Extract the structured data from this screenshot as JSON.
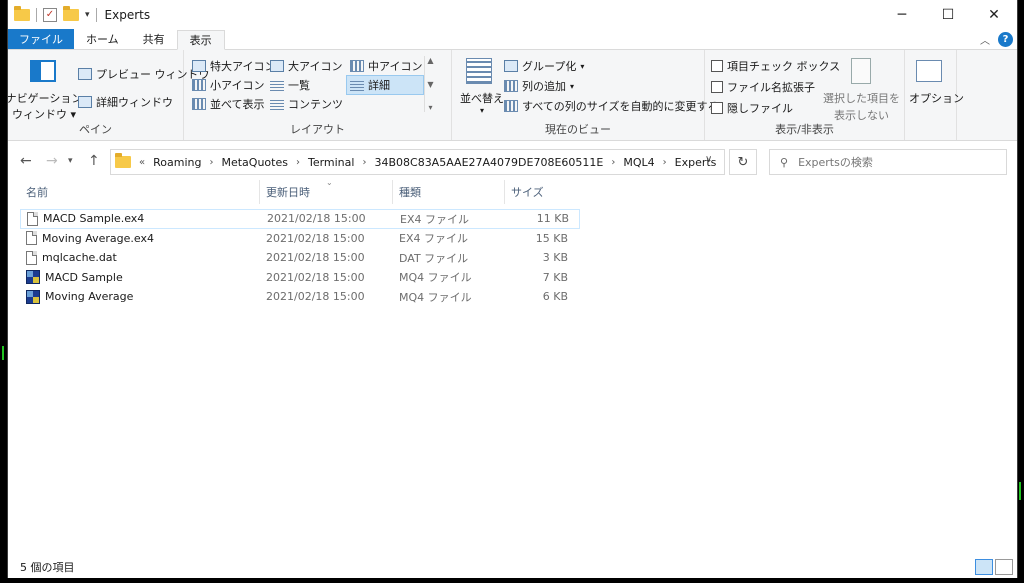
{
  "window": {
    "title": "Experts"
  },
  "tabs": [
    {
      "label": "ファイル"
    },
    {
      "label": "ホーム"
    },
    {
      "label": "共有"
    },
    {
      "label": "表示"
    }
  ],
  "ribbon": {
    "pane": {
      "nav_pane_line1": "ナビゲーション",
      "nav_pane_line2": "ウィンドウ",
      "preview": "プレビュー ウィンドウ",
      "details": "詳細ウィンドウ",
      "label": "ペイン"
    },
    "layout": {
      "items": [
        "特大アイコン",
        "大アイコン",
        "中アイコン",
        "小アイコン",
        "一覧",
        "詳細",
        "並べて表示",
        "コンテンツ"
      ],
      "label": "レイアウト"
    },
    "current_view": {
      "sort": "並べ替え",
      "group": "グループ化",
      "add_column": "列の追加",
      "autosize": "すべての列のサイズを自動的に変更する",
      "label": "現在のビュー"
    },
    "show_hide": {
      "item_checkbox": "項目チェック ボックス",
      "extensions": "ファイル名拡張子",
      "hidden": "隠しファイル",
      "hide_selected_line1": "選択した項目を",
      "hide_selected_line2": "表示しない",
      "label": "表示/非表示"
    },
    "options": {
      "label": "オプション"
    }
  },
  "address": {
    "overflow": "«",
    "crumbs": [
      "Roaming",
      "MetaQuotes",
      "Terminal",
      "34B08C83A5AAE27A4079DE708E60511E",
      "MQL4",
      "Experts"
    ]
  },
  "search": {
    "placeholder": "Expertsの検索"
  },
  "columns": {
    "name": "名前",
    "date": "更新日時",
    "type": "種類",
    "size": "サイズ"
  },
  "files": [
    {
      "name": "MACD Sample.ex4",
      "date": "2021/02/18 15:00",
      "type": "EX4 ファイル",
      "size": "11 KB",
      "icon": "file-icon"
    },
    {
      "name": "Moving Average.ex4",
      "date": "2021/02/18 15:00",
      "type": "EX4 ファイル",
      "size": "15 KB",
      "icon": "file-icon"
    },
    {
      "name": "mqlcache.dat",
      "date": "2021/02/18 15:00",
      "type": "DAT ファイル",
      "size": "3 KB",
      "icon": "file-icon"
    },
    {
      "name": "MACD Sample",
      "date": "2021/02/18 15:00",
      "type": "MQ4 ファイル",
      "size": "7 KB",
      "icon": "mq4-file-icon"
    },
    {
      "name": "Moving Average",
      "date": "2021/02/18 15:00",
      "type": "MQ4 ファイル",
      "size": "6 KB",
      "icon": "mq4-file-icon"
    }
  ],
  "status": {
    "count": "5 個の項目"
  }
}
